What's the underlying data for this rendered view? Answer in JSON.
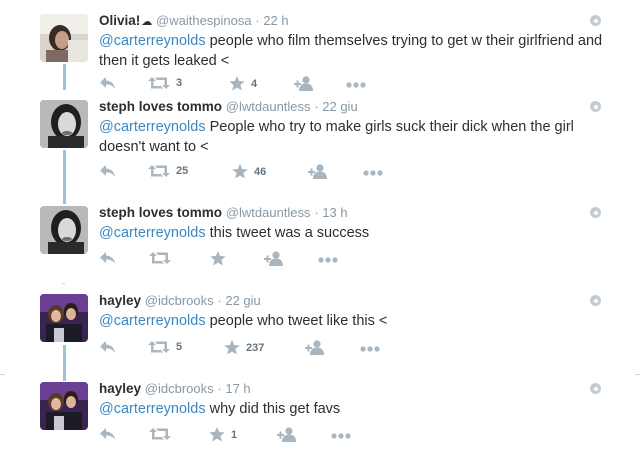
{
  "tweets": [
    {
      "name": "Olivia!",
      "handle": "@waithespinosa",
      "time": "· 22 h",
      "mention": "@carterreynolds",
      "text": " people who film themselves trying to get w their girlfriend and then it gets leaked <",
      "retweets": "3",
      "favorites": "4"
    },
    {
      "name": "steph loves tommo",
      "handle": "@lwtdauntless",
      "time": "· 22 giu",
      "mention": "@carterreynolds",
      "text": " People who try to make girls suck their dick when the girl doesn't want to <",
      "retweets": "25",
      "favorites": "46"
    },
    {
      "name": "steph loves tommo",
      "handle": "@lwtdauntless",
      "time": "· 13 h",
      "mention": "@carterreynolds",
      "text": " this tweet was a success",
      "retweets": "",
      "favorites": ""
    },
    {
      "name": "hayley",
      "handle": "@idcbrooks",
      "time": "· 22 giu",
      "mention": "@carterreynolds",
      "text": " people who tweet like this <",
      "retweets": "5",
      "favorites": "237"
    },
    {
      "name": "hayley",
      "handle": "@idcbrooks",
      "time": "· 17 h",
      "mention": "@carterreynolds",
      "text": " why did this get favs",
      "retweets": "",
      "favorites": "1"
    }
  ],
  "colors": {
    "accent": "#3b88c3",
    "thread_line": "#9bc2d8",
    "icon": "#a9b6c0"
  },
  "icons": [
    "reply-icon",
    "retweet-icon",
    "favorite-icon",
    "follow-icon",
    "more-icon",
    "settings-dot-icon"
  ]
}
